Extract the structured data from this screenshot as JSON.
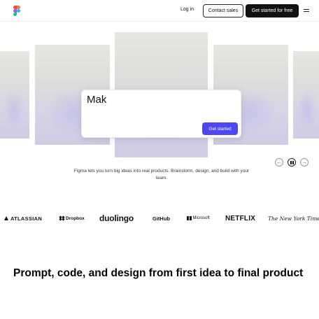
{
  "header": {
    "login_label": "Log in",
    "contact_label": "Contact sales",
    "start_label": "Get started for free"
  },
  "hero": {
    "prompt_text": "Mak",
    "prompt_button": "Get started",
    "tagline": "Figma lets you turn big ideas into real products. Brainstorm, design, and build with your team."
  },
  "carousel_controls": {
    "prev_icon": "arrow-left-icon",
    "pause_icon": "pause-icon",
    "next_icon": "arrow-right-icon"
  },
  "logos": {
    "atlassian": "ATLASSIAN",
    "dropbox": "Dropbox",
    "duolingo": "duolingo",
    "github": "GitHub",
    "microsoft": "Microsoft",
    "netflix": "NETFLIX",
    "nyt": "The New York Times"
  },
  "section": {
    "headline": "Prompt, code, and design from first idea to final product"
  },
  "colors": {
    "accent": "#4e46f0",
    "primary_button": "#111111"
  }
}
